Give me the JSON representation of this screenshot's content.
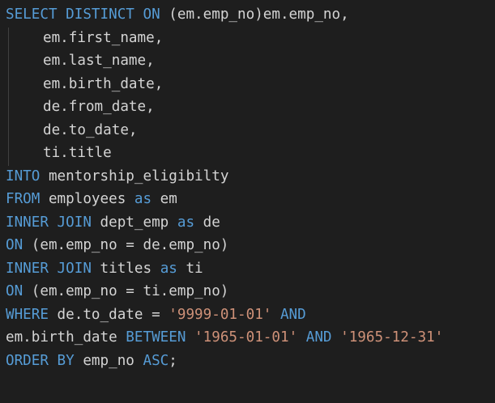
{
  "editor": {
    "theme": {
      "background": "#1e1e1e",
      "text": "#d4d4d4",
      "keyword": "#569cd6",
      "string": "#ce9178"
    },
    "code": {
      "l1": {
        "kw": "SELECT DISTINCT ON",
        "rest": " (em.emp_no)em.emp_no,"
      },
      "l2": "em.first_name,",
      "l3": "em.last_name,",
      "l4": "em.birth_date,",
      "l5": "de.from_date,",
      "l6": "de.to_date,",
      "l7": "ti.title",
      "l8": {
        "kw": "INTO",
        "rest": " mentorship_eligibilty"
      },
      "l9": {
        "kw": "FROM",
        "mid": " employees ",
        "kw2": "as",
        "rest": " em"
      },
      "l10": {
        "kw": "INNER JOIN",
        "mid": " dept_emp ",
        "kw2": "as",
        "rest": " de"
      },
      "l11": {
        "kw": "ON",
        "rest": " (em.emp_no = de.emp_no)"
      },
      "l12": {
        "kw": "INNER JOIN",
        "mid": " titles ",
        "kw2": "as",
        "rest": " ti"
      },
      "l13": {
        "kw": "ON",
        "rest": " (em.emp_no = ti.emp_no)"
      },
      "l14": {
        "kw": "WHERE",
        "mid": " de.to_date = ",
        "str": "'9999-01-01'",
        "sp": " ",
        "kw2": "AND"
      },
      "l15": {
        "a": "em.birth_date ",
        "kw": "BETWEEN",
        "sp1": " ",
        "str1": "'1965-01-01'",
        "sp2": " ",
        "kw2": "AND",
        "sp3": " ",
        "str2": "'1965-12-31'"
      },
      "l16": {
        "kw": "ORDER BY",
        "mid": " emp_no ",
        "kw2": "ASC",
        "rest": ";"
      }
    }
  }
}
